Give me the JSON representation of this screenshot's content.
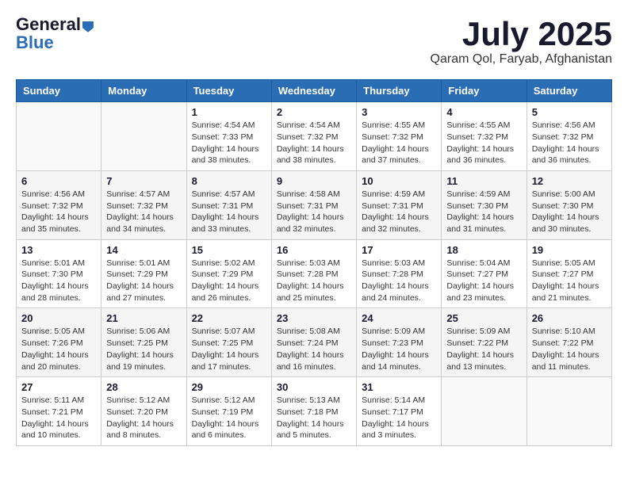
{
  "header": {
    "logo_general": "General",
    "logo_blue": "Blue",
    "month_year": "July 2025",
    "location": "Qaram Qol, Faryab, Afghanistan"
  },
  "days_of_week": [
    "Sunday",
    "Monday",
    "Tuesday",
    "Wednesday",
    "Thursday",
    "Friday",
    "Saturday"
  ],
  "weeks": [
    [
      {
        "day": "",
        "info": ""
      },
      {
        "day": "",
        "info": ""
      },
      {
        "day": "1",
        "info": "Sunrise: 4:54 AM\nSunset: 7:33 PM\nDaylight: 14 hours and 38 minutes."
      },
      {
        "day": "2",
        "info": "Sunrise: 4:54 AM\nSunset: 7:32 PM\nDaylight: 14 hours and 38 minutes."
      },
      {
        "day": "3",
        "info": "Sunrise: 4:55 AM\nSunset: 7:32 PM\nDaylight: 14 hours and 37 minutes."
      },
      {
        "day": "4",
        "info": "Sunrise: 4:55 AM\nSunset: 7:32 PM\nDaylight: 14 hours and 36 minutes."
      },
      {
        "day": "5",
        "info": "Sunrise: 4:56 AM\nSunset: 7:32 PM\nDaylight: 14 hours and 36 minutes."
      }
    ],
    [
      {
        "day": "6",
        "info": "Sunrise: 4:56 AM\nSunset: 7:32 PM\nDaylight: 14 hours and 35 minutes."
      },
      {
        "day": "7",
        "info": "Sunrise: 4:57 AM\nSunset: 7:32 PM\nDaylight: 14 hours and 34 minutes."
      },
      {
        "day": "8",
        "info": "Sunrise: 4:57 AM\nSunset: 7:31 PM\nDaylight: 14 hours and 33 minutes."
      },
      {
        "day": "9",
        "info": "Sunrise: 4:58 AM\nSunset: 7:31 PM\nDaylight: 14 hours and 32 minutes."
      },
      {
        "day": "10",
        "info": "Sunrise: 4:59 AM\nSunset: 7:31 PM\nDaylight: 14 hours and 32 minutes."
      },
      {
        "day": "11",
        "info": "Sunrise: 4:59 AM\nSunset: 7:30 PM\nDaylight: 14 hours and 31 minutes."
      },
      {
        "day": "12",
        "info": "Sunrise: 5:00 AM\nSunset: 7:30 PM\nDaylight: 14 hours and 30 minutes."
      }
    ],
    [
      {
        "day": "13",
        "info": "Sunrise: 5:01 AM\nSunset: 7:30 PM\nDaylight: 14 hours and 28 minutes."
      },
      {
        "day": "14",
        "info": "Sunrise: 5:01 AM\nSunset: 7:29 PM\nDaylight: 14 hours and 27 minutes."
      },
      {
        "day": "15",
        "info": "Sunrise: 5:02 AM\nSunset: 7:29 PM\nDaylight: 14 hours and 26 minutes."
      },
      {
        "day": "16",
        "info": "Sunrise: 5:03 AM\nSunset: 7:28 PM\nDaylight: 14 hours and 25 minutes."
      },
      {
        "day": "17",
        "info": "Sunrise: 5:03 AM\nSunset: 7:28 PM\nDaylight: 14 hours and 24 minutes."
      },
      {
        "day": "18",
        "info": "Sunrise: 5:04 AM\nSunset: 7:27 PM\nDaylight: 14 hours and 23 minutes."
      },
      {
        "day": "19",
        "info": "Sunrise: 5:05 AM\nSunset: 7:27 PM\nDaylight: 14 hours and 21 minutes."
      }
    ],
    [
      {
        "day": "20",
        "info": "Sunrise: 5:05 AM\nSunset: 7:26 PM\nDaylight: 14 hours and 20 minutes."
      },
      {
        "day": "21",
        "info": "Sunrise: 5:06 AM\nSunset: 7:25 PM\nDaylight: 14 hours and 19 minutes."
      },
      {
        "day": "22",
        "info": "Sunrise: 5:07 AM\nSunset: 7:25 PM\nDaylight: 14 hours and 17 minutes."
      },
      {
        "day": "23",
        "info": "Sunrise: 5:08 AM\nSunset: 7:24 PM\nDaylight: 14 hours and 16 minutes."
      },
      {
        "day": "24",
        "info": "Sunrise: 5:09 AM\nSunset: 7:23 PM\nDaylight: 14 hours and 14 minutes."
      },
      {
        "day": "25",
        "info": "Sunrise: 5:09 AM\nSunset: 7:22 PM\nDaylight: 14 hours and 13 minutes."
      },
      {
        "day": "26",
        "info": "Sunrise: 5:10 AM\nSunset: 7:22 PM\nDaylight: 14 hours and 11 minutes."
      }
    ],
    [
      {
        "day": "27",
        "info": "Sunrise: 5:11 AM\nSunset: 7:21 PM\nDaylight: 14 hours and 10 minutes."
      },
      {
        "day": "28",
        "info": "Sunrise: 5:12 AM\nSunset: 7:20 PM\nDaylight: 14 hours and 8 minutes."
      },
      {
        "day": "29",
        "info": "Sunrise: 5:12 AM\nSunset: 7:19 PM\nDaylight: 14 hours and 6 minutes."
      },
      {
        "day": "30",
        "info": "Sunrise: 5:13 AM\nSunset: 7:18 PM\nDaylight: 14 hours and 5 minutes."
      },
      {
        "day": "31",
        "info": "Sunrise: 5:14 AM\nSunset: 7:17 PM\nDaylight: 14 hours and 3 minutes."
      },
      {
        "day": "",
        "info": ""
      },
      {
        "day": "",
        "info": ""
      }
    ]
  ]
}
